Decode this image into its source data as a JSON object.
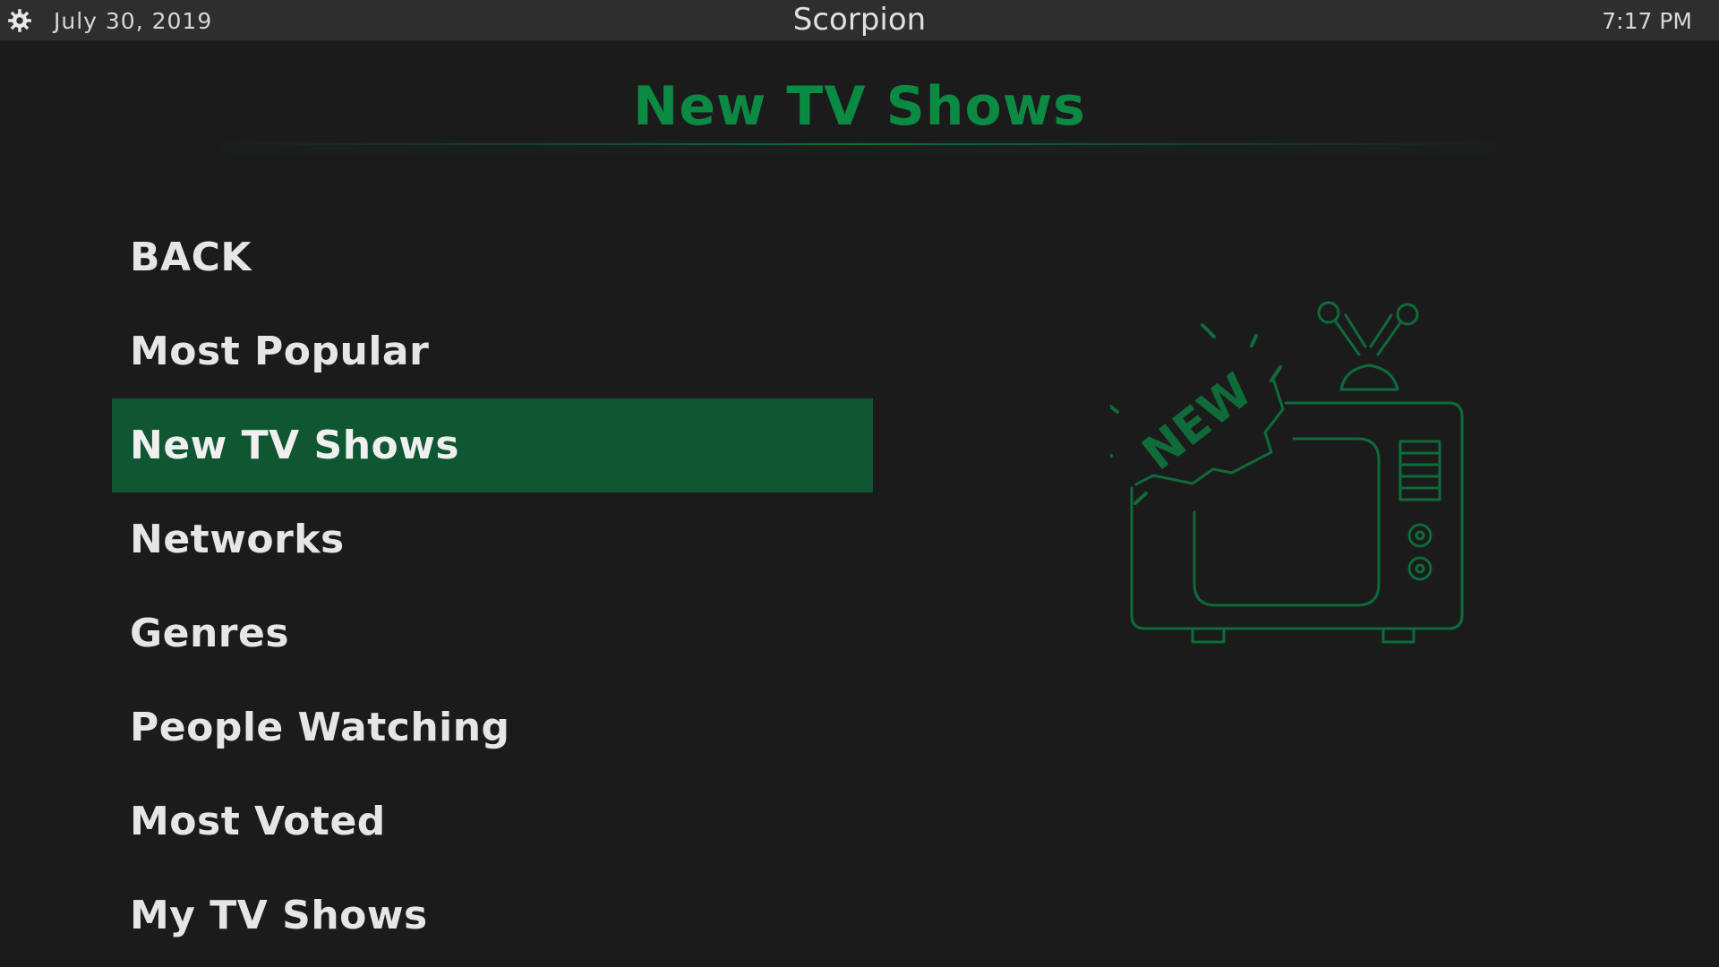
{
  "topbar": {
    "settings_icon": "gear-icon",
    "date": "July 30, 2019",
    "app_title": "Scorpion",
    "time": "7:17 PM"
  },
  "page": {
    "title": "New TV Shows"
  },
  "menu": {
    "selected_index": 2,
    "items": [
      {
        "label": "BACK"
      },
      {
        "label": "Most Popular"
      },
      {
        "label": "New TV Shows"
      },
      {
        "label": "Networks"
      },
      {
        "label": "Genres"
      },
      {
        "label": "People Watching"
      },
      {
        "label": "Most Voted"
      },
      {
        "label": "My TV Shows"
      }
    ]
  },
  "artwork": {
    "icon": "new-tv-icon",
    "badge_text": "NEW"
  },
  "colors": {
    "accent": "#0b8a43",
    "selected_bg": "#0f5733",
    "background": "#1b1b1b",
    "topbar_bg": "#2e2e2e"
  }
}
